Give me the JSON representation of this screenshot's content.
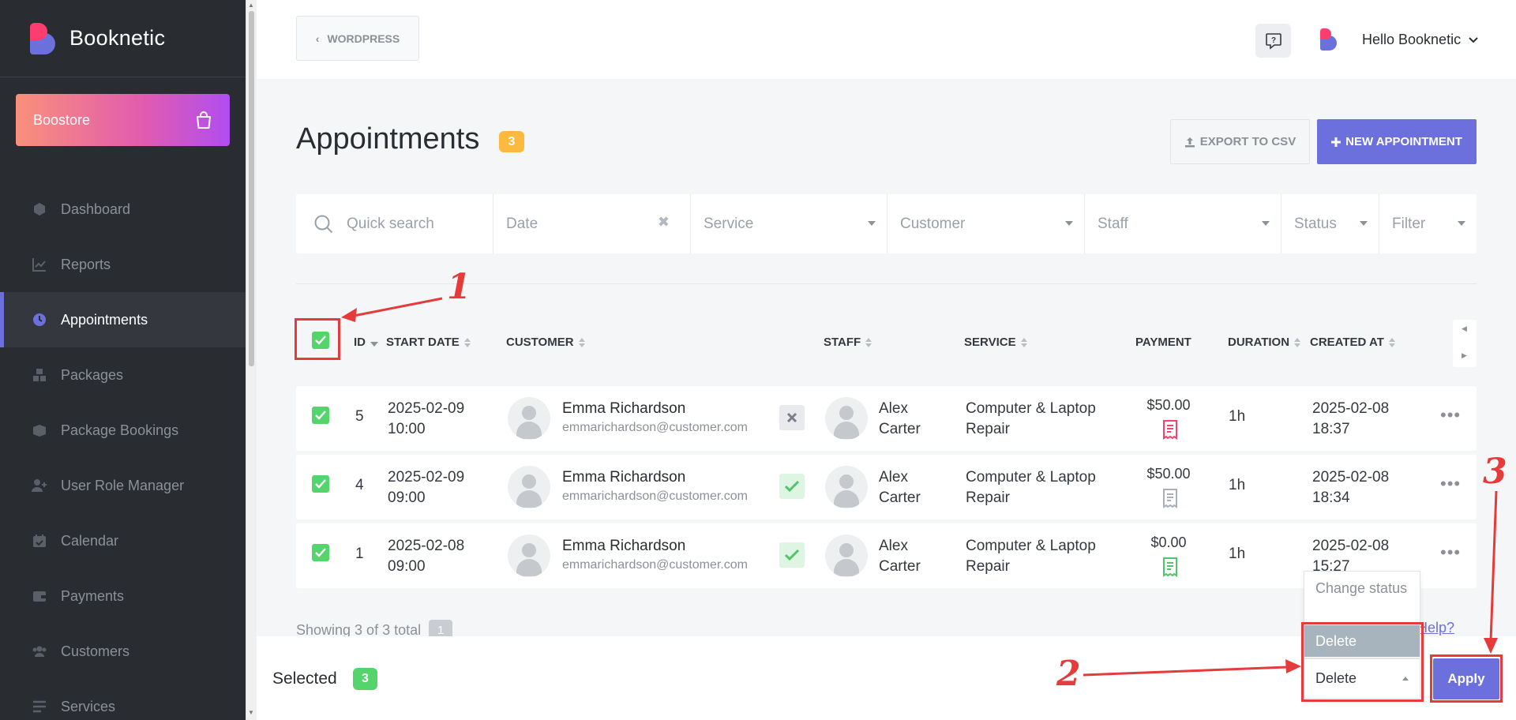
{
  "sidebar": {
    "brand": "Booknetic",
    "boostore": "Boostore",
    "items": [
      {
        "label": "Dashboard"
      },
      {
        "label": "Reports"
      },
      {
        "label": "Appointments"
      },
      {
        "label": "Packages"
      },
      {
        "label": "Package Bookings"
      },
      {
        "label": "User Role Manager"
      },
      {
        "label": "Calendar"
      },
      {
        "label": "Payments"
      },
      {
        "label": "Customers"
      },
      {
        "label": "Services"
      }
    ],
    "active_index": 2
  },
  "topbar": {
    "back_label": "WORDPRESS",
    "user_greeting": "Hello Booknetic"
  },
  "page": {
    "title": "Appointments",
    "count": "3",
    "export_label": "EXPORT TO CSV",
    "new_label": "NEW APPOINTMENT"
  },
  "filters": {
    "search_placeholder": "Quick search",
    "date": "Date",
    "service": "Service",
    "customer": "Customer",
    "staff": "Staff",
    "status": "Status",
    "filter": "Filter"
  },
  "table": {
    "headers": {
      "id": "ID",
      "start_date": "START DATE",
      "customer": "CUSTOMER",
      "staff": "STAFF",
      "service": "SERVICE",
      "payment": "PAYMENT",
      "duration": "DURATION",
      "created_at": "CREATED AT"
    },
    "rows": [
      {
        "id": "5",
        "date": "2025-02-09",
        "time": "10:00",
        "customer_name": "Emma Richardson",
        "customer_email": "emmarichardson@customer.com",
        "status": "cancel",
        "staff_first": "Alex",
        "staff_last": "Carter",
        "service_1": "Computer & Laptop",
        "service_2": "Repair",
        "payment": "$50.00",
        "payment_color": "#f0466e",
        "duration": "1h",
        "created_date": "2025-02-08",
        "created_time": "18:37"
      },
      {
        "id": "4",
        "date": "2025-02-09",
        "time": "09:00",
        "customer_name": "Emma Richardson",
        "customer_email": "emmarichardson@customer.com",
        "status": "ok",
        "staff_first": "Alex",
        "staff_last": "Carter",
        "service_1": "Computer & Laptop",
        "service_2": "Repair",
        "payment": "$50.00",
        "payment_color": "#aab0b8",
        "duration": "1h",
        "created_date": "2025-02-08",
        "created_time": "18:34"
      },
      {
        "id": "1",
        "date": "2025-02-08",
        "time": "09:00",
        "customer_name": "Emma Richardson",
        "customer_email": "emmarichardson@customer.com",
        "status": "ok",
        "staff_first": "Alex",
        "staff_last": "Carter",
        "service_1": "Computer & Laptop",
        "service_2": "Repair",
        "payment": "$0.00",
        "payment_color": "#53c46a",
        "duration": "1h",
        "created_date": "2025-02-08",
        "created_time": "15:27"
      }
    ]
  },
  "footer": {
    "showing": "Showing 3 of 3 total",
    "page": "1",
    "need_help": "d Help?"
  },
  "bulk": {
    "selected_label": "Selected",
    "selected_count": "3",
    "dropdown_options": [
      "Change status",
      "Delete"
    ],
    "dropdown_selected": "Delete",
    "select_value": "Delete",
    "apply_label": "Apply"
  },
  "annotations": {
    "n1": "1",
    "n2": "2",
    "n3": "3"
  },
  "colors": {
    "accent": "#6c70dc",
    "sidebar_bg": "#292d32",
    "success": "#53d56c",
    "warning": "#fbba3e",
    "annotation": "#e53b3b"
  }
}
